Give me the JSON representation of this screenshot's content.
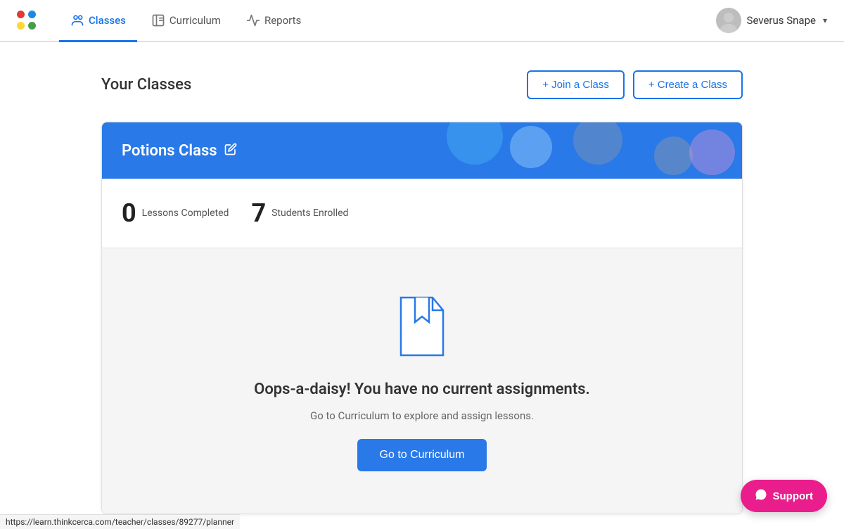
{
  "app": {
    "logo_alt": "App Logo"
  },
  "navbar": {
    "items": [
      {
        "id": "classes",
        "label": "Classes",
        "active": true,
        "icon": "classes-icon"
      },
      {
        "id": "curriculum",
        "label": "Curriculum",
        "active": false,
        "icon": "curriculum-icon"
      },
      {
        "id": "reports",
        "label": "Reports",
        "active": false,
        "icon": "reports-icon"
      }
    ],
    "user": {
      "name": "Severus Snape",
      "chevron": "▾"
    }
  },
  "page": {
    "title": "Your Classes",
    "join_button": "+ Join a Class",
    "create_button": "+ Create a Class"
  },
  "class_card": {
    "title": "Potions Class",
    "stats": {
      "lessons_completed_count": "0",
      "lessons_completed_label": "Lessons Completed",
      "students_enrolled_count": "7",
      "students_enrolled_label": "Students Enrolled"
    },
    "empty_state": {
      "title": "Oops-a-daisy! You have no current assignments.",
      "subtitle": "Go to Curriculum to explore and assign lessons.",
      "cta_button": "Go to Curriculum"
    }
  },
  "support": {
    "label": "Support"
  },
  "status_bar": {
    "url": "https://learn.thinkcerca.com/teacher/classes/89277/planner"
  }
}
